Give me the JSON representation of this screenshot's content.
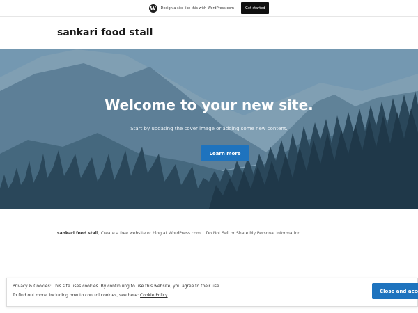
{
  "promo": {
    "logo_letter": "W",
    "text": "Design a site like this with WordPress.com",
    "button_label": "Get started"
  },
  "header": {
    "site_title": "sankari food stall"
  },
  "cover": {
    "heading": "Welcome to your new site.",
    "subtext": "Start by updating the cover image or adding some new content.",
    "button_label": "Learn more"
  },
  "footer": {
    "site_name": "sankari food stall",
    "separator": ", ",
    "link_create": "Create a free website or blog at WordPress.com.",
    "link_privacy": "Do Not Sell or Share My Personal Information"
  },
  "cookie": {
    "line1": "Privacy & Cookies: This site uses cookies. By continuing to use this website, you agree to their use.",
    "line2_prefix": "To find out more, including how to control cookies, see here: ",
    "policy_link": "Cookie Policy",
    "button_label": "Close and accept"
  },
  "colors": {
    "accent": "#1e73be",
    "promo_button": "#101010"
  }
}
